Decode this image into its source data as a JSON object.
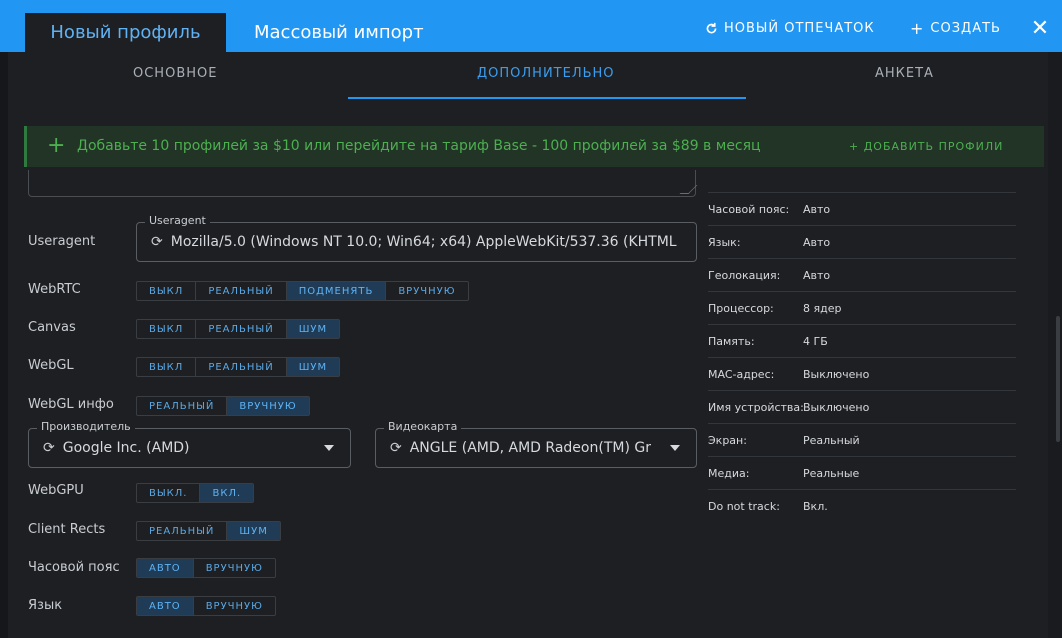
{
  "header": {
    "tab_new_profile": "Новый профиль",
    "tab_bulk_import": "Массовый импорт",
    "new_fingerprint_label": "НОВЫЙ ОТПЕЧАТОК",
    "create_label": "СОЗДАТЬ",
    "accent_color": "#2196f3"
  },
  "subtabs": {
    "main": "ОСНОВНОЕ",
    "advanced": "ДОПОЛНИТЕЛЬНО",
    "survey": "АНКЕТА"
  },
  "banner": {
    "text": "Добавьте 10 профилей за $10 или перейдите на тариф Base - 100 профилей за $89 в месяц",
    "action": "+ ДОБАВИТЬ ПРОФИЛИ",
    "color": "#4caf50"
  },
  "useragent": {
    "label": "Useragent",
    "legend": "Useragent",
    "value": "Mozilla/5.0 (Windows NT 10.0; Win64; x64) AppleWebKit/537.36 (KHTML"
  },
  "webrtc": {
    "label": "WebRTC",
    "options": [
      "ВЫКЛ",
      "РЕАЛЬНЫЙ",
      "ПОДМЕНЯТЬ",
      "ВРУЧНУЮ"
    ],
    "selected": "ПОДМЕНЯТЬ"
  },
  "canvas": {
    "label": "Canvas",
    "options": [
      "ВЫКЛ",
      "РЕАЛЬНЫЙ",
      "ШУМ"
    ],
    "selected": "ШУМ"
  },
  "webgl": {
    "label": "WebGL",
    "options": [
      "ВЫКЛ",
      "РЕАЛЬНЫЙ",
      "ШУМ"
    ],
    "selected": "ШУМ"
  },
  "webgl_info": {
    "label": "WebGL инфо",
    "options": [
      "РЕАЛЬНЫЙ",
      "ВРУЧНУЮ"
    ],
    "selected": "ВРУЧНУЮ"
  },
  "vendor": {
    "legend": "Производитель",
    "value": "Google Inc. (AMD)"
  },
  "renderer": {
    "legend": "Видеокарта",
    "value": "ANGLE (AMD, AMD Radeon(TM) Gr"
  },
  "webgpu": {
    "label": "WebGPU",
    "options": [
      "ВЫКЛ.",
      "ВКЛ."
    ],
    "selected": "ВКЛ."
  },
  "client_rects": {
    "label": "Client Rects",
    "options": [
      "РЕАЛЬНЫЙ",
      "ШУМ"
    ],
    "selected": "ШУМ"
  },
  "timezone": {
    "label": "Часовой пояс",
    "options": [
      "АВТО",
      "ВРУЧНУЮ"
    ],
    "selected": "АВТО"
  },
  "language": {
    "label": "Язык",
    "options": [
      "АВТО",
      "ВРУЧНУЮ"
    ],
    "selected": "АВТО"
  },
  "summary": [
    {
      "key": "Часовой пояс:",
      "value": "Авто"
    },
    {
      "key": "Язык:",
      "value": "Авто"
    },
    {
      "key": "Геолокация:",
      "value": "Авто"
    },
    {
      "key": "Процессор:",
      "value": "8 ядер"
    },
    {
      "key": "Память:",
      "value": "4 ГБ"
    },
    {
      "key": "MAC-адрес:",
      "value": "Выключено"
    },
    {
      "key": "Имя устройства:",
      "value": "Выключено"
    },
    {
      "key": "Экран:",
      "value": "Реальный"
    },
    {
      "key": "Медиа:",
      "value": "Реальные"
    },
    {
      "key": "Do not track:",
      "value": "Вкл."
    }
  ]
}
